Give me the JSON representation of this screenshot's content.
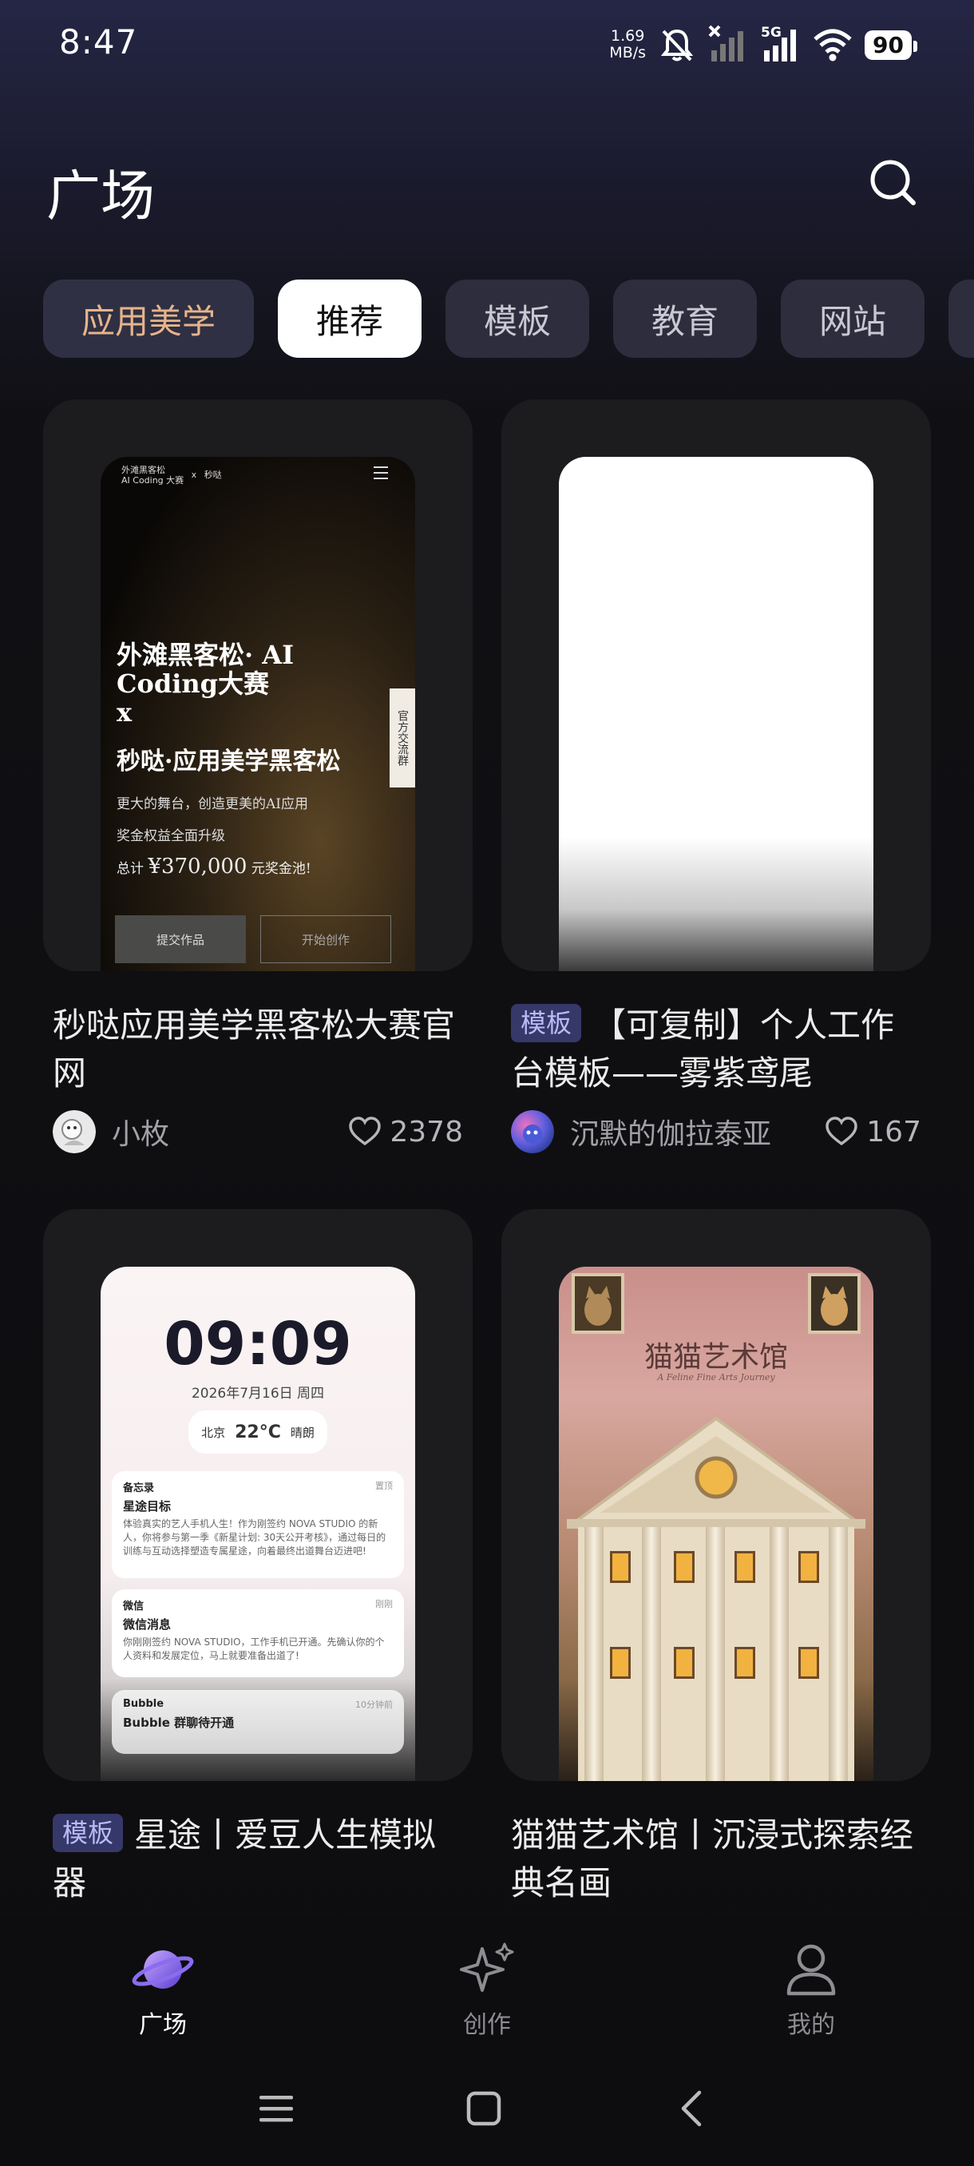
{
  "status_bar": {
    "time": "8:47",
    "net_speed_value": "1.69",
    "net_speed_unit": "MB/s",
    "network_type": "5G",
    "battery": "90"
  },
  "header": {
    "title": "广场"
  },
  "tabs": [
    {
      "label": "应用美学",
      "state": "highlighted"
    },
    {
      "label": "推荐",
      "state": "selected"
    },
    {
      "label": "模板",
      "state": "normal"
    },
    {
      "label": "教育",
      "state": "normal"
    },
    {
      "label": "网站",
      "state": "normal"
    },
    {
      "label": "",
      "state": "normal"
    }
  ],
  "cards": [
    {
      "title": "秒哒应用美学黑客松大赛官网",
      "tag": "",
      "author": "小枚",
      "likes": "2378",
      "preview": {
        "top_left": "外滩黑客松\nAI Coding 大赛",
        "top_x": "x",
        "top_brand": "秒哒",
        "headline": "外滩黑客松· AI Coding大赛",
        "headline_x": "x",
        "subheadline": "秒哒·应用美学黑客松",
        "line1": "更大的舞台，创造更美的AI应用",
        "line2": "奖金权益全面升级",
        "total_prefix": "总计",
        "total_amount": "¥370,000",
        "total_suffix": "元奖金池!",
        "side_label": "官方交流群",
        "button_submit": "提交作品",
        "button_create": "开始创作"
      }
    },
    {
      "title": "【可复制】个人工作台模板——雾紫鸢尾",
      "tag": "模板",
      "author": "沉默的伽拉泰亚",
      "likes": "167"
    },
    {
      "title": "星途丨爱豆人生模拟器",
      "tag": "模板",
      "author": "",
      "likes": "",
      "preview": {
        "time": "09:09",
        "date": "2026年7月16日 周四",
        "city": "北京",
        "temp": "22°C",
        "weather": "晴朗",
        "notes": [
          {
            "app": "备忘录",
            "when": "置顶",
            "title": "星途目标",
            "body": "体验真实的艺人手机人生！作为刚签约 NOVA STUDIO 的新人，你将参与第一季《新星计划: 30天公开考核》，通过每日的训练与互动选择塑造专属星途，向着最终出道舞台迈进吧!"
          },
          {
            "app": "微信",
            "when": "刚刚",
            "title": "微信消息",
            "body": "你刚刚签约 NOVA STUDIO，工作手机已开通。先确认你的个人资料和发展定位，马上就要准备出道了!"
          },
          {
            "app": "Bubble",
            "when": "10分钟前",
            "title": "Bubble 群聊待开通",
            "body": ""
          }
        ]
      }
    },
    {
      "title": "猫猫艺术馆丨沉浸式探索经典名画",
      "tag": "",
      "author": "",
      "likes": "",
      "preview": {
        "title": "猫猫艺术馆",
        "subtitle": "A Feline Fine Arts Journey"
      }
    }
  ],
  "bottom_nav": [
    {
      "label": "广场",
      "icon": "planet-icon",
      "active": true
    },
    {
      "label": "创作",
      "icon": "sparkle-icon",
      "active": false
    },
    {
      "label": "我的",
      "icon": "person-icon",
      "active": false
    }
  ],
  "colors": {
    "accent_tab_text": "#e7b48c",
    "tag_bg": "#36386a",
    "tag_text": "#b9bcf4",
    "planet_purple": "#8a6cf0"
  }
}
